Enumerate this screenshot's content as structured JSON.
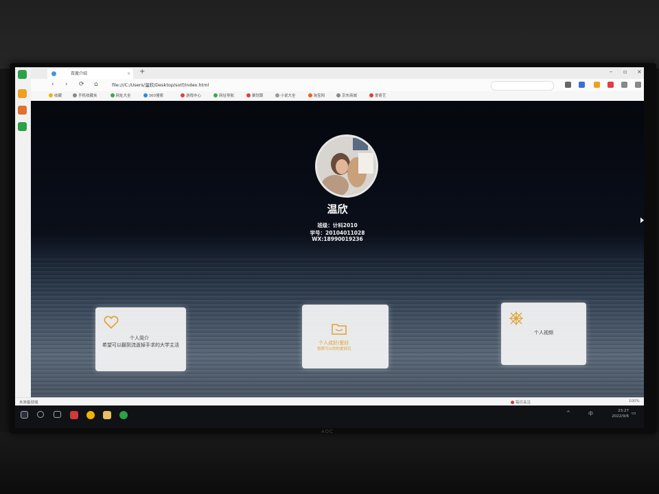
{
  "browser": {
    "tab_title": "百度介绍",
    "tab_close": "×",
    "new_tab": "+",
    "url": "file:///C:/Users/温欣/Desktop/sotf/index.html",
    "nav": {
      "back": "‹",
      "forward": "›",
      "refresh": "⟳",
      "home": "⌂"
    },
    "window": {
      "min": "–",
      "max": "▫",
      "close": "×"
    },
    "bookmarks": [
      {
        "label": "收藏",
        "color": "#f0b400"
      },
      {
        "label": "手机收藏夹",
        "color": "#888888"
      },
      {
        "label": "网址大全",
        "color": "#3aa84b"
      },
      {
        "label": "360搜索",
        "color": "#2a8be0"
      },
      {
        "label": "游戏中心",
        "color": "#e04040"
      },
      {
        "label": "网址导航",
        "color": "#3aa84b"
      },
      {
        "label": "聚划算",
        "color": "#e04040"
      },
      {
        "label": "小说大全",
        "color": "#999999"
      },
      {
        "label": "淘宝网",
        "color": "#f06020"
      },
      {
        "label": "京东商城",
        "color": "#888888"
      },
      {
        "label": "爱奇艺",
        "color": "#e04040"
      }
    ]
  },
  "profile": {
    "name": "温欣",
    "class_line": "班级：计科2010",
    "student_id_line": "学号：20104011028",
    "wx_line": "WX:18990019236"
  },
  "cards": [
    {
      "icon": "heart-icon",
      "title": "个人简介",
      "desc": "希望可以翻到流逝掉手求的大学主活"
    },
    {
      "icon": "folder-icon",
      "title": "个人成好/爱好",
      "desc": "我很可以的的爱好后"
    },
    {
      "icon": "gift-icon",
      "title": "个人视频",
      "desc": ""
    }
  ],
  "statusbar": {
    "left": "未准备就绪",
    "right_items": [
      "每日关注",
      "100%"
    ]
  },
  "taskbar": {
    "time": "23:27",
    "date": "2022/9/6",
    "ime": "中"
  },
  "colors": {
    "accent_gold": "#e0a030",
    "card_bg": "#f5f5f5",
    "page_bg": "#05070d"
  }
}
